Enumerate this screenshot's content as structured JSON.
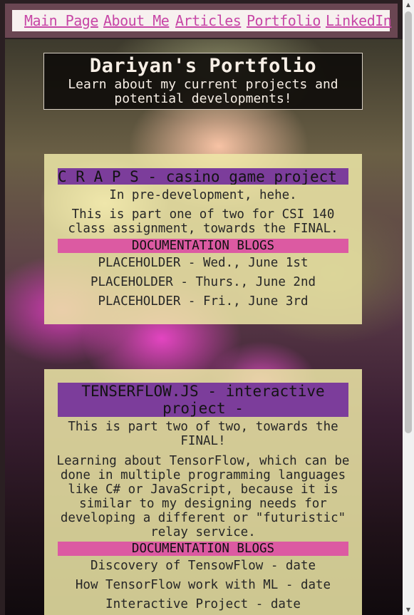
{
  "nav": {
    "links": [
      "Main Page",
      "About Me",
      "Articles",
      "Portfolio",
      "LinkedIn"
    ]
  },
  "header": {
    "title": "Dariyan's Portfolio",
    "subtitle_line1": "Learn about my current projects and",
    "subtitle_line2": "potential developments!"
  },
  "projects": [
    {
      "title": "C R A P S - casino game project -",
      "lines": [
        "In pre-development, hehe.",
        "This is part one of two for CSI 140",
        "class assignment, towards the FINAL."
      ],
      "docs_heading": "DOCUMENTATION BLOGS",
      "blogs": [
        "PLACEHOLDER - Wed., June 1st",
        "PLACEHOLDER - Thurs., June 2nd",
        "PLACEHOLDER - Fri., June 3rd"
      ]
    },
    {
      "title_line1": "TENSERFLOW.JS - interactive",
      "title_line2": "project -",
      "lines": [
        "This is part two of two, towards the",
        "FINAL!",
        "Learning about TensorFlow, which can be",
        "done in multiple programming languages",
        "like C# or JavaScript, because it is",
        "similar to my designing needs for",
        "developing a different or \"futuristic\"",
        "relay service."
      ],
      "docs_heading": "DOCUMENTATION BLOGS",
      "blogs": [
        "Discovery of TensowFlow - date",
        "How TensorFlow work with ML - date",
        "Interactive Project - date"
      ]
    }
  ],
  "colors": {
    "nav_frame": "#6a4652",
    "link": "#c746a6",
    "card_bg": "#eee9a8",
    "title_bar": "#7c3d9b",
    "docs_bar": "#dc5aa2"
  }
}
